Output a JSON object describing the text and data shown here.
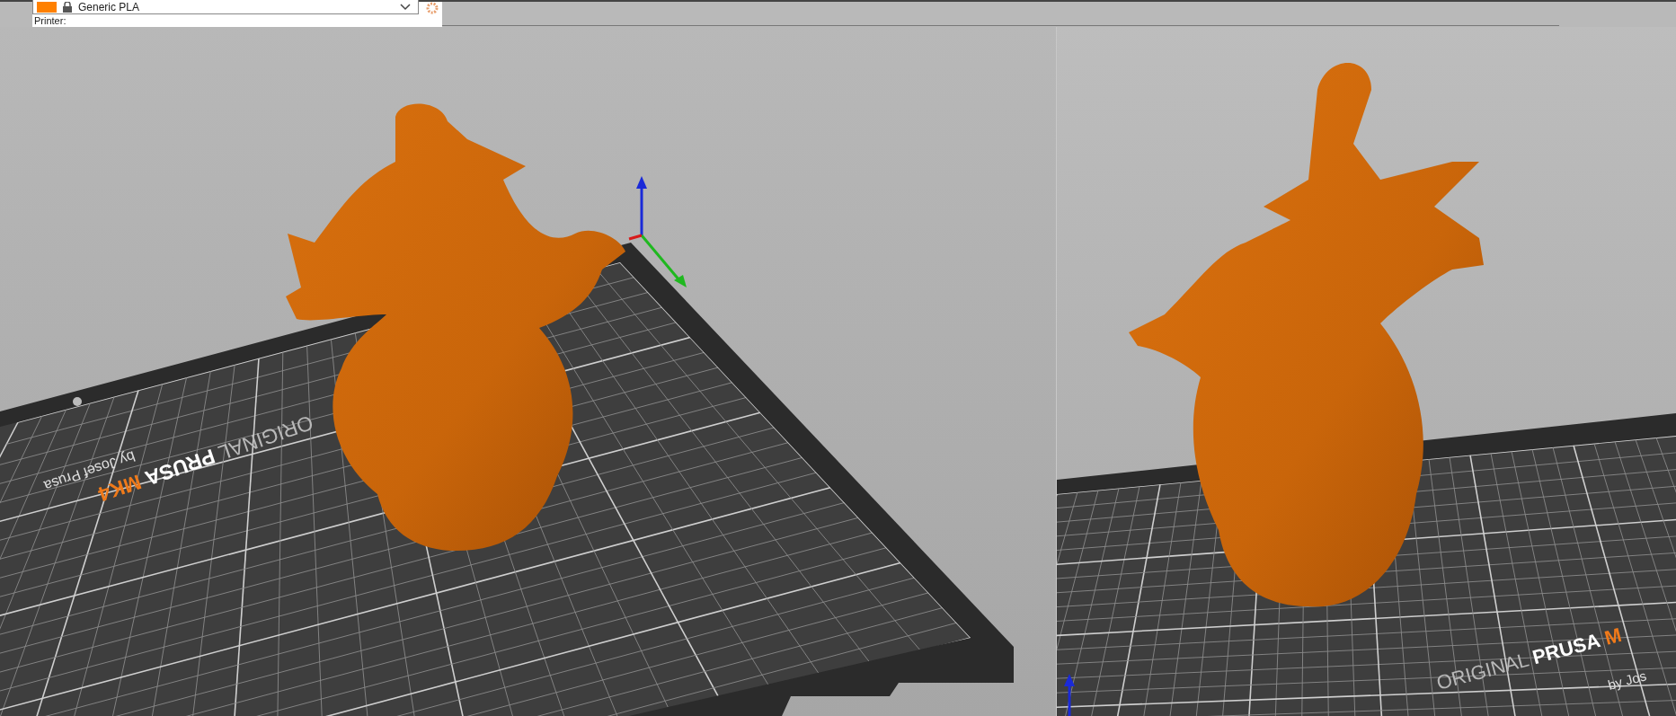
{
  "filament": {
    "name": "Generic PLA"
  },
  "printer_label": "Printer:",
  "viewports": [
    {
      "bed_label": {
        "original": "ORIGINAL",
        "prusa": "PRUSA",
        "model": "MK4",
        "byline": "by Josef Prusa"
      }
    },
    {
      "bed_label": {
        "original": "ORIGINAL",
        "prusa": "PRUSA",
        "model": "M",
        "byline": "by Jos"
      }
    }
  ]
}
